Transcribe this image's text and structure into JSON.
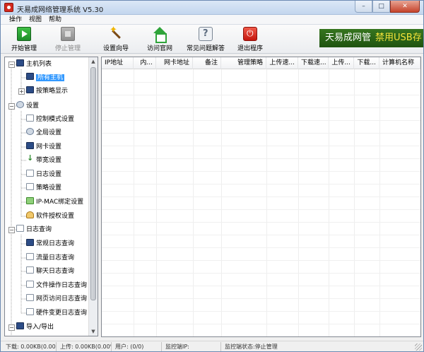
{
  "window": {
    "title": "天易成网络管理系统 V5.30",
    "controls": {
      "minimize": "–",
      "maximize": "□",
      "close": "✕"
    }
  },
  "menu": [
    "操作",
    "视图",
    "帮助"
  ],
  "toolbar": {
    "start": {
      "label": "开始管理",
      "icon": "play-icon"
    },
    "stop": {
      "label": "停止管理",
      "icon": "stop-icon",
      "disabled": true
    },
    "wizard": {
      "label": "设置向导",
      "icon": "wand-icon"
    },
    "website": {
      "label": "访问官网",
      "icon": "home-icon"
    },
    "faq": {
      "label": "常见问题解答",
      "icon": "faq-icon"
    },
    "exit": {
      "label": "退出程序",
      "icon": "power-icon"
    }
  },
  "banner": {
    "text": "天易成网管",
    "highlight": "禁用USB存",
    "bg": "#2a6318",
    "highlight_color": "#f6e43a"
  },
  "tree": {
    "groups": [
      {
        "label": "主机列表",
        "children": [
          "所有主机",
          "按策略显示"
        ]
      },
      {
        "label": "设置",
        "children": [
          "控制模式设置",
          "全局设置",
          "网卡设置",
          "带宽设置",
          "日志设置",
          "策略设置",
          "IP-MAC绑定设置",
          "软件授权设置"
        ]
      },
      {
        "label": "日志查询",
        "children": [
          "常规日志查询",
          "流量日志查询",
          "聊天日志查询",
          "文件操作日志查询",
          "网页访问日志查询",
          "硬件变更日志查询"
        ]
      },
      {
        "label": "导入/导出",
        "children": []
      }
    ],
    "selected": "所有主机",
    "selection_color": "#3399ff"
  },
  "table": {
    "columns": [
      "IP地址",
      "内...",
      "网卡地址",
      "备注",
      "管理策略",
      "上传速...",
      "下载速...",
      "上传...",
      "下载...",
      "计算机名称"
    ],
    "rows": []
  },
  "status": {
    "download": "下载: 0.00KB(0.00%)",
    "upload": "上传: 0.00KB(0.00%)",
    "users": "用户: (0/0)",
    "monitor_ip": "监控端IP:",
    "monitor_state": "监控端状态:停止管理"
  }
}
